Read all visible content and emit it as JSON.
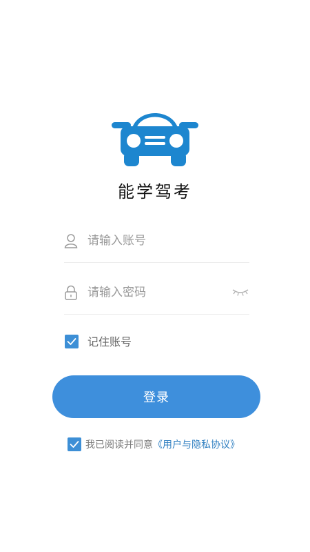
{
  "app": {
    "title": "能学驾考",
    "brand_color": "#1d86cf"
  },
  "form": {
    "account_placeholder": "请输入账号",
    "password_placeholder": "请输入密码",
    "account_value": "",
    "password_value": "",
    "remember_label": "记住账号",
    "remember_checked": true,
    "login_label": "登录"
  },
  "agreement": {
    "prefix": "我已阅读并同意",
    "link_text": "《用户与隐私协议》",
    "checked": true
  },
  "icons": {
    "logo": "car-logo-icon",
    "account": "user-icon",
    "password": "lock-icon",
    "visibility": "eye-closed-icon",
    "check": "checkmark-icon"
  },
  "colors": {
    "primary_button": "#3e8fdc",
    "checkbox": "#3d8fd6",
    "link": "#2f7fc1"
  }
}
